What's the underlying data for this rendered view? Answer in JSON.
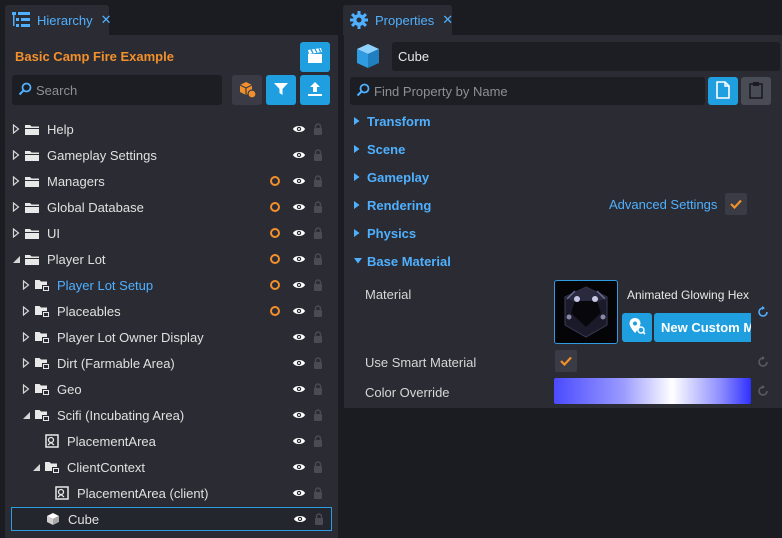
{
  "hierarchy": {
    "tab_label": "Hierarchy",
    "project_title": "Basic Camp Fire Example",
    "search_placeholder": "Search",
    "tree": [
      {
        "label": "Help",
        "icon": "folder-icon",
        "depth": 0,
        "expander": "collapsed",
        "dot": false,
        "highlight": false
      },
      {
        "label": "Gameplay Settings",
        "icon": "folder-icon",
        "depth": 0,
        "expander": "collapsed",
        "dot": false,
        "highlight": false
      },
      {
        "label": "Managers",
        "icon": "folder-icon",
        "depth": 0,
        "expander": "collapsed",
        "dot": true,
        "highlight": false
      },
      {
        "label": "Global Database",
        "icon": "folder-icon",
        "depth": 0,
        "expander": "collapsed",
        "dot": true,
        "highlight": false
      },
      {
        "label": "UI",
        "icon": "folder-icon",
        "depth": 0,
        "expander": "collapsed",
        "dot": true,
        "highlight": false
      },
      {
        "label": "Player Lot",
        "icon": "folder-icon",
        "depth": 0,
        "expander": "expanded",
        "dot": true,
        "highlight": false
      },
      {
        "label": "Player Lot Setup",
        "icon": "group-icon",
        "depth": 1,
        "expander": "collapsed",
        "dot": true,
        "highlight": true
      },
      {
        "label": "Placeables",
        "icon": "group-icon",
        "depth": 1,
        "expander": "collapsed",
        "dot": true,
        "highlight": false
      },
      {
        "label": "Player Lot Owner Display",
        "icon": "group-icon",
        "depth": 1,
        "expander": "collapsed",
        "dot": false,
        "highlight": false
      },
      {
        "label": "Dirt (Farmable Area)",
        "icon": "group-icon",
        "depth": 1,
        "expander": "collapsed",
        "dot": false,
        "highlight": false
      },
      {
        "label": "Geo",
        "icon": "group-icon",
        "depth": 1,
        "expander": "collapsed",
        "dot": false,
        "highlight": false
      },
      {
        "label": "Scifi (Incubating Area)",
        "icon": "group-icon",
        "depth": 1,
        "expander": "expanded",
        "dot": false,
        "highlight": false
      },
      {
        "label": "PlacementArea",
        "icon": "script-icon",
        "depth": 2,
        "expander": "none",
        "dot": false,
        "highlight": false
      },
      {
        "label": "ClientContext",
        "icon": "group-icon",
        "depth": 2,
        "expander": "expanded",
        "dot": false,
        "highlight": false
      },
      {
        "label": "PlacementArea (client)",
        "icon": "script-icon",
        "depth": 3,
        "expander": "none",
        "dot": false,
        "highlight": false
      },
      {
        "label": "Cube",
        "icon": "cube-icon",
        "depth": 2,
        "expander": "none",
        "dot": false,
        "highlight": false,
        "selected": true
      }
    ]
  },
  "properties": {
    "tab_label": "Properties",
    "object_name": "Cube",
    "find_placeholder": "Find Property by Name",
    "sections": [
      {
        "title": "Transform",
        "expanded": false
      },
      {
        "title": "Scene",
        "expanded": false
      },
      {
        "title": "Gameplay",
        "expanded": false
      },
      {
        "title": "Rendering",
        "expanded": false
      },
      {
        "title": "Physics",
        "expanded": false
      },
      {
        "title": "Base Material",
        "expanded": true
      }
    ],
    "advanced_settings_label": "Advanced Settings",
    "advanced_settings_checked": true,
    "material_label": "Material",
    "material_name": "Animated Glowing Hex",
    "new_custom_material_label": "New Custom Ma",
    "use_smart_material_label": "Use Smart Material",
    "use_smart_material_checked": true,
    "color_override_label": "Color Override"
  },
  "colors": {
    "accent_blue": "#1f9fe0",
    "link_blue": "#4fb0ff",
    "accent_orange": "#f2902c",
    "panel": "#2b2c33",
    "background": "#1b1c22"
  }
}
